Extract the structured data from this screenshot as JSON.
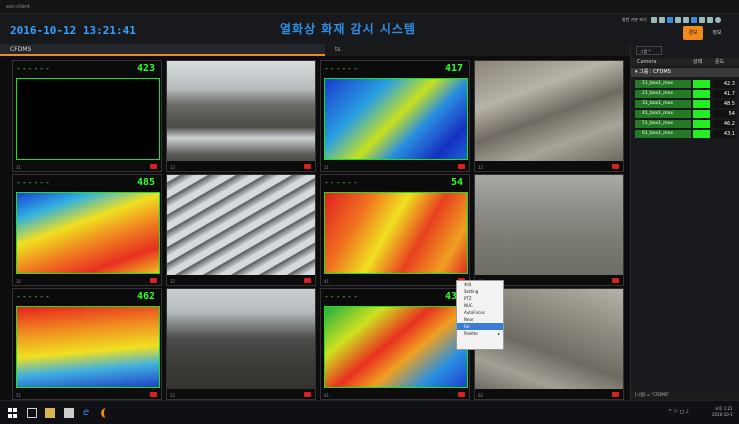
{
  "app": {
    "window_title": "ezc-client",
    "datetime": "2016-10-12 13:21:41",
    "title": "열화상 화재 감시 시스템",
    "toolbar_label": "창번 기본 보기",
    "btn_primary": "경보",
    "btn_info": "정보"
  },
  "tabs": [
    {
      "label": "CFDMS"
    },
    {
      "label": "ts"
    }
  ],
  "cameras": [
    {
      "seg": "------",
      "temp": "423",
      "id": "11"
    },
    {
      "id": "12"
    },
    {
      "seg": "------",
      "temp": "417",
      "id": "21"
    },
    {
      "id": "22"
    },
    {
      "seg": "------",
      "temp": "485",
      "id": "31"
    },
    {
      "id": "32"
    },
    {
      "seg": "------",
      "temp": "54",
      "id": "41"
    },
    {
      "id": "42"
    },
    {
      "seg": "------",
      "temp": "462",
      "id": "51"
    },
    {
      "id": "52"
    },
    {
      "seg": "------",
      "temp": "431",
      "id": "61"
    },
    {
      "id": "62"
    }
  ],
  "context_menu": [
    {
      "label": "최대"
    },
    {
      "label": "Setting"
    },
    {
      "label": "PTZ"
    },
    {
      "label": "NUC"
    },
    {
      "label": "AutoFocus"
    },
    {
      "label": "Near"
    },
    {
      "label": "Far"
    },
    {
      "label": "Palette"
    }
  ],
  "right_panel": {
    "group_label": "그룹 *",
    "col_camera": "Camera",
    "col_status": "상태",
    "col_temp": "온도",
    "tree_node": "그룹 : CFDMS",
    "rows": [
      {
        "name": "11_box1_max",
        "temp": "42.3"
      },
      {
        "name": "21_box1_max",
        "temp": "41.7"
      },
      {
        "name": "31_box1_max",
        "temp": "48.5"
      },
      {
        "name": "41_box1_max",
        "temp": "54"
      },
      {
        "name": "51_box1_max",
        "temp": "46.2"
      },
      {
        "name": "61_box1_max",
        "temp": "43.1"
      }
    ],
    "footer": "[그룹] = \"CFDMS\""
  },
  "taskbar": {
    "time": "오후 1:21",
    "date": "2016-10-1"
  },
  "colors": {
    "accent": "#f08a1a",
    "title_blue": "#2b8fe5",
    "lcd_green": "#2cff2c"
  }
}
